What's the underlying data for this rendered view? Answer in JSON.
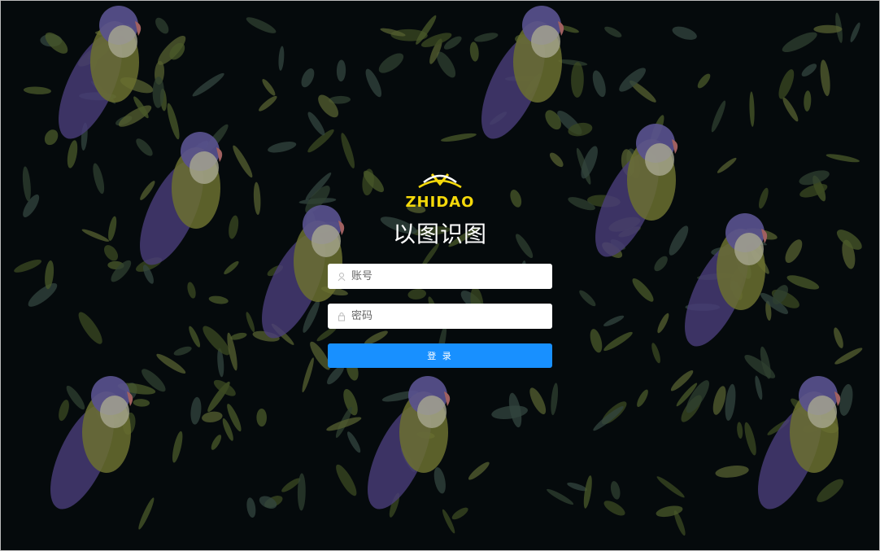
{
  "brand": {
    "logo_text": "ZHIDAO",
    "title": "以图识图"
  },
  "form": {
    "username": {
      "placeholder": "账号",
      "value": "",
      "icon": "user-icon"
    },
    "password": {
      "placeholder": "密码",
      "value": "",
      "icon": "lock-icon"
    },
    "submit_label": "登 录"
  },
  "colors": {
    "accent": "#1890ff",
    "logo_yellow": "#f5d90a",
    "background": "#050a0c"
  }
}
